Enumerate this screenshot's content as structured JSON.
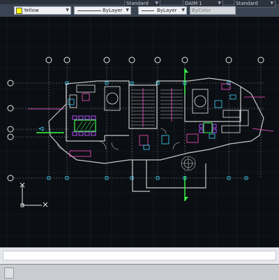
{
  "toolbar": {
    "top_style_1": "Standard",
    "top_style_2": "DAIM 1",
    "top_style_3": "Standard",
    "color_control": "Yellow",
    "linetype_control": "ByLayer",
    "lineweight_control": "ByLayer",
    "plotstyle_control": "ByColor"
  },
  "colors": {
    "canvas": "#0b0e12",
    "grid": "#182230",
    "walls": "#c7c7c7",
    "accent_yellow": "#ffff00",
    "accent_green": "#3cff4b",
    "accent_magenta": "#ff4fc8",
    "accent_cyan": "#3fd7ff"
  },
  "grid_bubble_count_top": 9,
  "grid_bubble_count_left": 5,
  "ucs_icon": "ucs-icon",
  "statusbar": {
    "command_placeholder": ""
  },
  "tabs": [
    {
      "label": ""
    }
  ]
}
